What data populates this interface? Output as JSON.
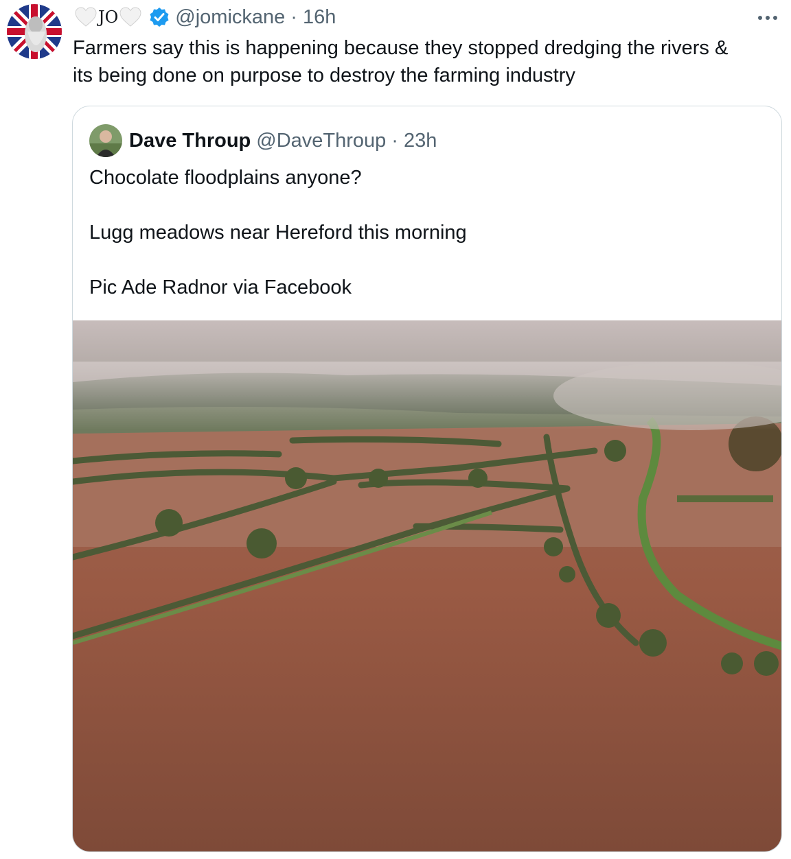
{
  "tweet": {
    "display_name_text": "JO",
    "handle": "@jomickane",
    "separator": "·",
    "time": "16h",
    "text_line1": "Farmers say this is happening because they stopped dredging the rivers &",
    "text_line2": "its being done on purpose to destroy the farming industry"
  },
  "quoted_tweet": {
    "display_name": "Dave Throup",
    "handle": "@DaveThroup",
    "separator": "·",
    "time": "23h",
    "paragraphs": [
      "Chocolate floodplains anyone?",
      "Lugg meadows near Hereford this morning",
      "Pic Ade Radnor via Facebook"
    ]
  },
  "icons": {
    "avatar": "union-jack-avatar",
    "hearts": "white-heart-icon",
    "verified": "verified-badge-icon",
    "more": "more-options-icon"
  },
  "colors": {
    "text_primary": "#0f1419",
    "text_secondary": "#536471",
    "verified_blue": "#1d9bf0",
    "border": "#cfd9de",
    "flood_water": "#9a5a44"
  }
}
